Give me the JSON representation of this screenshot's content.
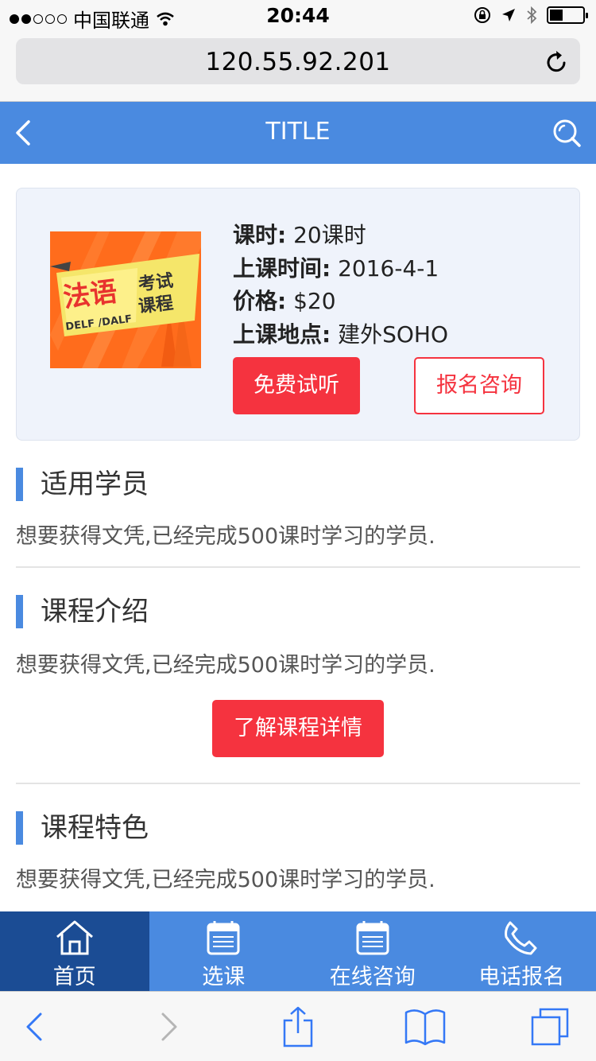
{
  "status_bar": {
    "carrier": "中国联通",
    "time": "20:44",
    "signal_icon": "signal-dots-icon",
    "wifi_icon": "wifi-icon",
    "lock_icon": "orientation-lock-icon",
    "location_icon": "location-arrow-icon",
    "bluetooth_icon": "bluetooth-icon",
    "battery_icon": "battery-icon"
  },
  "browser": {
    "url": "120.55.92.201",
    "reload_icon": "reload-icon"
  },
  "header": {
    "title": "TITLE",
    "back_icon": "chevron-left-icon",
    "search_icon": "search-icon",
    "color": "#4a8ae0"
  },
  "course": {
    "image": {
      "title_main": "法语",
      "title_side_1": "考试",
      "title_side_2": "课程",
      "subtitle": "DELF /DALF"
    },
    "hours_label": "课时:",
    "hours_value": "20课时",
    "date_label": "上课时间:",
    "date_value": "2016-4-1",
    "price_label": "价格:",
    "price_value": "$20",
    "location_label": "上课地点:",
    "location_value": "建外SOHO",
    "trial_button": "免费试听",
    "consult_button": "报名咨询",
    "accent_color": "#f5333f"
  },
  "sections": [
    {
      "title": "适用学员",
      "text": "想要获得文凭,已经完成500课时学习的学员."
    },
    {
      "title": "课程介绍",
      "text": "想要获得文凭,已经完成500课时学习的学员.",
      "button": "了解课程详情"
    },
    {
      "title": "课程特色",
      "text": "想要获得文凭,已经完成500课时学习的学员."
    }
  ],
  "tabbar": {
    "items": [
      {
        "label": "首页",
        "icon": "home-icon",
        "active": true
      },
      {
        "label": "选课",
        "icon": "calendar-icon",
        "active": false
      },
      {
        "label": "在线咨询",
        "icon": "calendar-icon",
        "active": false
      },
      {
        "label": "电话报名",
        "icon": "phone-icon",
        "active": false
      }
    ],
    "active_color": "#1b4c94"
  },
  "safari_toolbar": {
    "back_icon": "chevron-left-icon",
    "forward_icon": "chevron-right-icon",
    "share_icon": "share-icon",
    "bookmarks_icon": "book-icon",
    "tabs_icon": "tabs-icon"
  }
}
